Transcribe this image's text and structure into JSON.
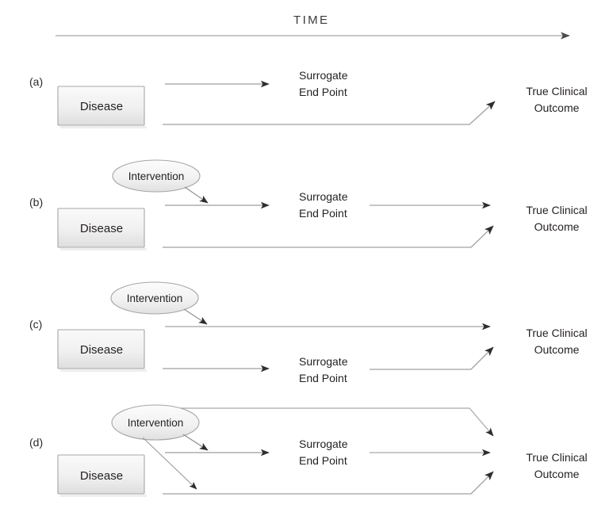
{
  "figure": {
    "axis_title": "TIME",
    "background_color": "#ffffff",
    "line_color": "#9a9a9a",
    "arrow_color": "#3c3c3c",
    "text_color": "#231f20",
    "box_fill_top": "#f6f6f6",
    "box_fill_bottom": "#e2e2e2",
    "box_border": "#a6a6a6",
    "ellipse_fill_top": "#fbfbfb",
    "ellipse_fill_bottom": "#e6e6e6",
    "ellipse_border": "#a6a6a6"
  },
  "labels": {
    "disease": "Disease",
    "intervention": "Intervention",
    "surrogate_line1": "Surrogate",
    "surrogate_line2": "End Point",
    "outcome_line1": "True Clinical",
    "outcome_line2": "Outcome"
  },
  "panels": [
    {
      "id": "a",
      "tag": "(a)",
      "nodes": [
        "disease",
        "surrogate-end-point",
        "true-clinical-outcome"
      ],
      "description": "Disease leads to a surrogate end point and, by a separate pathway, to the true clinical outcome."
    },
    {
      "id": "b",
      "tag": "(b)",
      "nodes": [
        "intervention",
        "disease",
        "surrogate-end-point",
        "true-clinical-outcome"
      ],
      "description": "Intervention acts on the pathway from disease to surrogate end point, and the surrogate end point leads to the true clinical outcome."
    },
    {
      "id": "c",
      "tag": "(c)",
      "nodes": [
        "intervention",
        "disease",
        "surrogate-end-point",
        "true-clinical-outcome"
      ],
      "description": "Intervention acts on the direct disease-to-outcome pathway, while a separate unaffected pathway runs through the surrogate end point."
    },
    {
      "id": "d",
      "tag": "(d)",
      "nodes": [
        "intervention",
        "disease",
        "surrogate-end-point",
        "true-clinical-outcome"
      ],
      "description": "Intervention affects multiple pathways; three arrows converge on the true clinical outcome."
    }
  ]
}
